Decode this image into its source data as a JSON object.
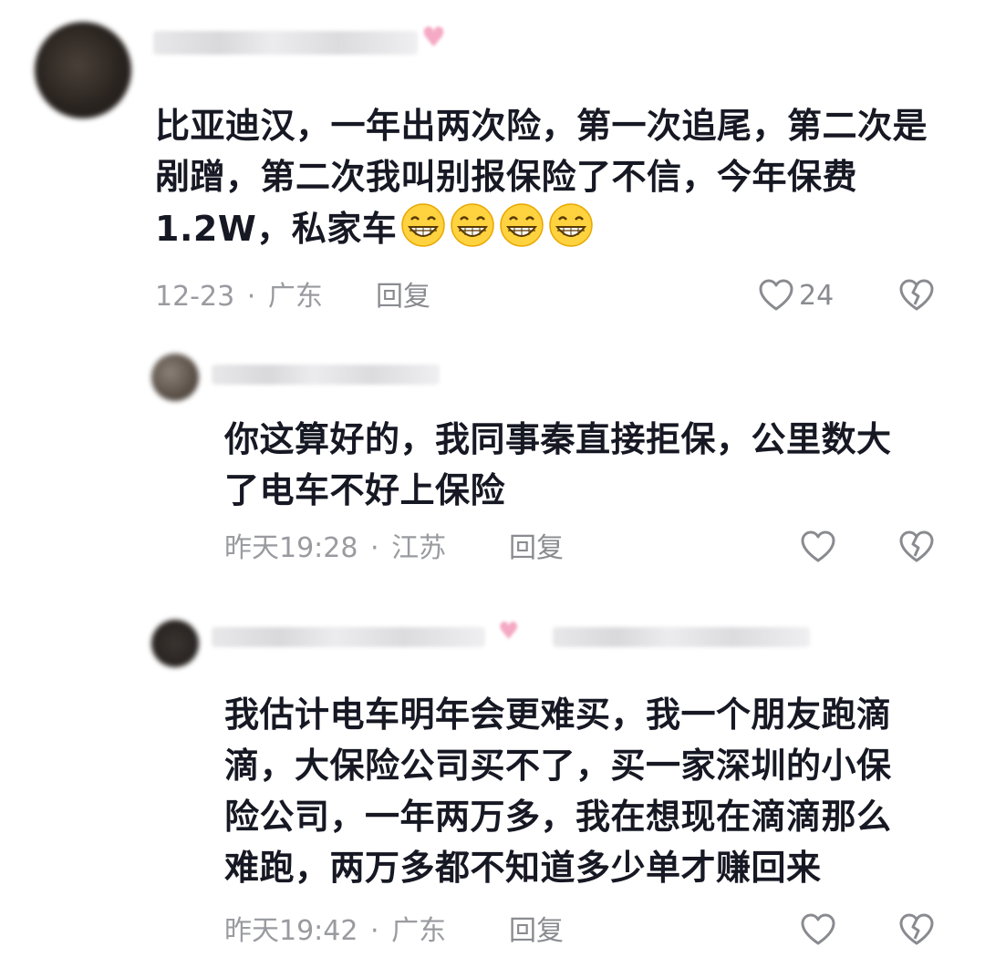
{
  "comments": [
    {
      "text_lines": [
        "比亚迪汉，一年出两次险，第一次追尾，第二次是",
        "剐蹭，第二次我叫别报保险了不信，今年保费",
        "1.2W，私家车"
      ],
      "emoji_icons": [
        "grinning-face-icon",
        "grinning-face-icon",
        "grinning-face-icon",
        "grinning-face-icon"
      ],
      "date": "12-23",
      "separator": "·",
      "location": "广东",
      "reply_label": "回复",
      "likes": "24"
    },
    {
      "text_lines": [
        "你这算好的，我同事秦直接拒保，公里数大",
        "了电车不好上保险"
      ],
      "date": "昨天19:28",
      "separator": "·",
      "location": "江苏",
      "reply_label": "回复",
      "likes": ""
    },
    {
      "text_lines": [
        "我估计电车明年会更难买，我一个朋友跑滴",
        "滴，大保险公司买不了，买一家深圳的小保",
        "险公司，一年两万多，我在想现在滴滴那么",
        "难跑，两万多都不知道多少单才赚回来"
      ],
      "date": "昨天19:42",
      "separator": "·",
      "location": "广东",
      "reply_label": "回复",
      "likes": ""
    }
  ],
  "colors": {
    "text": "#161823",
    "meta": "#9a9ba0",
    "icon": "#8a8b90",
    "emoji_face": "#ffd23f"
  }
}
